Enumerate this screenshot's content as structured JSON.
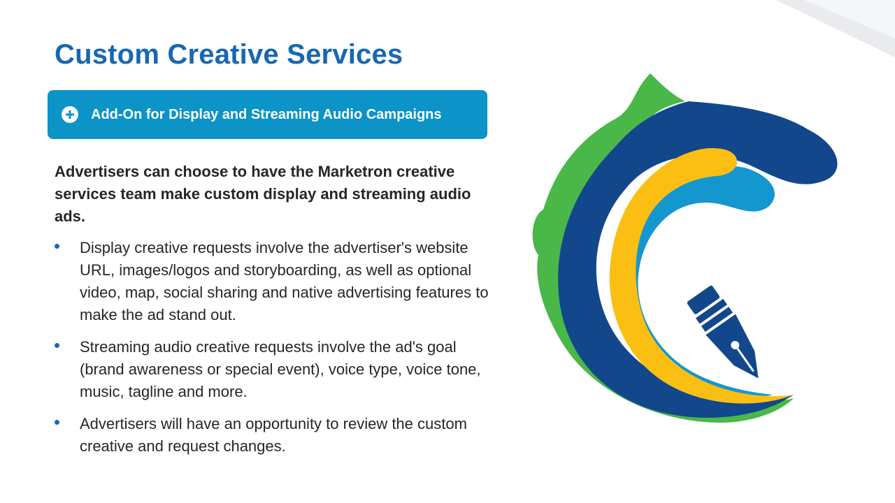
{
  "slide": {
    "title": "Custom Creative Services",
    "banner": {
      "icon": "plus-circle-icon",
      "label": "Add-On for Display and Streaming Audio Campaigns",
      "color": "#0c93c7"
    },
    "lead": "Advertisers can choose to have the Marketron creative services team make custom display and streaming audio ads.",
    "bullets": [
      "Display creative requests involve the advertiser's website URL, images/logos and storyboarding, as well as optional video, map, social sharing and native advertising features to make the ad stand out.",
      "Streaming audio creative requests involve the ad's goal (brand awareness or special event), voice type, voice tone, music, tagline and more.",
      "Advertisers will have an opportunity to review the custom creative and request changes."
    ]
  },
  "colors": {
    "title": "#1868b1",
    "logo_green": "#4ab749",
    "logo_navy": "#12478c",
    "logo_yellow": "#fbbf14",
    "logo_cyan": "#1497cf"
  }
}
